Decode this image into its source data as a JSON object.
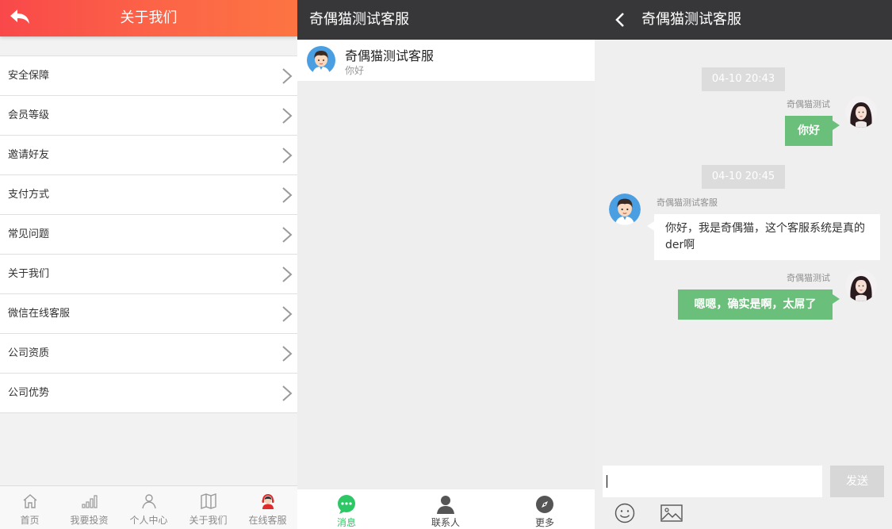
{
  "left_panel": {
    "title": "关于我们",
    "back_icon": "back-arrow-icon",
    "header_gradient": [
      "#f9484a",
      "#fd7442"
    ],
    "menu": [
      {
        "label": "安全保障"
      },
      {
        "label": "会员等级"
      },
      {
        "label": "邀请好友"
      },
      {
        "label": "支付方式"
      },
      {
        "label": "常见问题"
      },
      {
        "label": "关于我们"
      },
      {
        "label": "微信在线客服"
      },
      {
        "label": "公司资质"
      },
      {
        "label": "公司优势"
      }
    ],
    "tabbar": [
      {
        "label": "首页",
        "icon": "home-icon"
      },
      {
        "label": "我要投资",
        "icon": "signal-bars-icon"
      },
      {
        "label": "个人中心",
        "icon": "user-icon"
      },
      {
        "label": "关于我们",
        "icon": "map-icon"
      },
      {
        "label": "在线客服",
        "icon": "customer-service-icon"
      }
    ]
  },
  "middle_panel": {
    "title": "奇偶猫测试客服",
    "conversation": {
      "name": "奇偶猫测试客服",
      "last_message": "你好",
      "avatar": "boy-avatar-icon"
    },
    "tabbar": [
      {
        "label": "消息",
        "icon": "chat-bubble-icon",
        "active": true
      },
      {
        "label": "联系人",
        "icon": "person-icon",
        "active": false
      },
      {
        "label": "更多",
        "icon": "compass-icon",
        "active": false
      }
    ],
    "accent_color": "#2ec766"
  },
  "right_panel": {
    "title": "奇偶猫测试客服",
    "back_icon": "chevron-left-icon",
    "messages": [
      {
        "time": "04-10 20:43"
      },
      {
        "side": "right",
        "sender": "奇偶猫测试",
        "text": "你好",
        "avatar": "girl-avatar-icon"
      },
      {
        "time": "04-10 20:45"
      },
      {
        "side": "left",
        "sender": "奇偶猫测试客服",
        "text": "你好，我是奇偶猫，这个客服系统是真的der啊",
        "avatar": "boy-avatar-icon"
      },
      {
        "side": "right",
        "sender": "奇偶猫测试",
        "text": "嗯嗯，确实是啊，太屌了",
        "avatar": "girl-avatar-icon"
      }
    ],
    "input_value": "",
    "send_label": "发送",
    "toolbar": [
      "emoji-icon",
      "image-icon"
    ],
    "bubble_color": "#6ac07a"
  }
}
